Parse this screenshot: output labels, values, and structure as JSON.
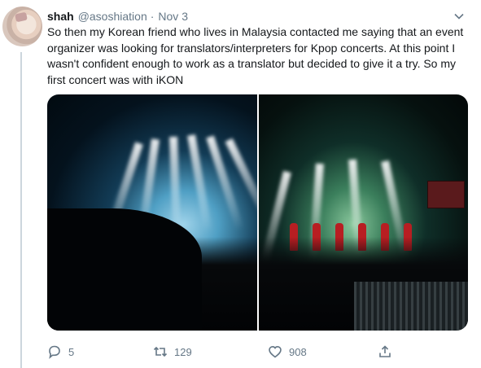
{
  "tweet": {
    "author_name": "shah",
    "handle": "@asoshiation",
    "separator": "·",
    "date": "Nov 3",
    "text": "So then my Korean friend who lives in Malaysia contacted me saying that an event organizer was looking for translators/interpreters for Kpop concerts. At this point I wasn't confident enough to work as a translator but decided to give it a try. So my first concert was with iKON"
  },
  "actions": {
    "reply_count": "5",
    "retweet_count": "129",
    "like_count": "908"
  },
  "icons": {
    "caret": "chevron-down-icon",
    "reply": "reply-icon",
    "retweet": "retweet-icon",
    "like": "heart-icon",
    "share": "share-icon"
  },
  "colors": {
    "text": "#14171a",
    "secondary": "#657786",
    "thread_line": "#ccd6dd"
  }
}
